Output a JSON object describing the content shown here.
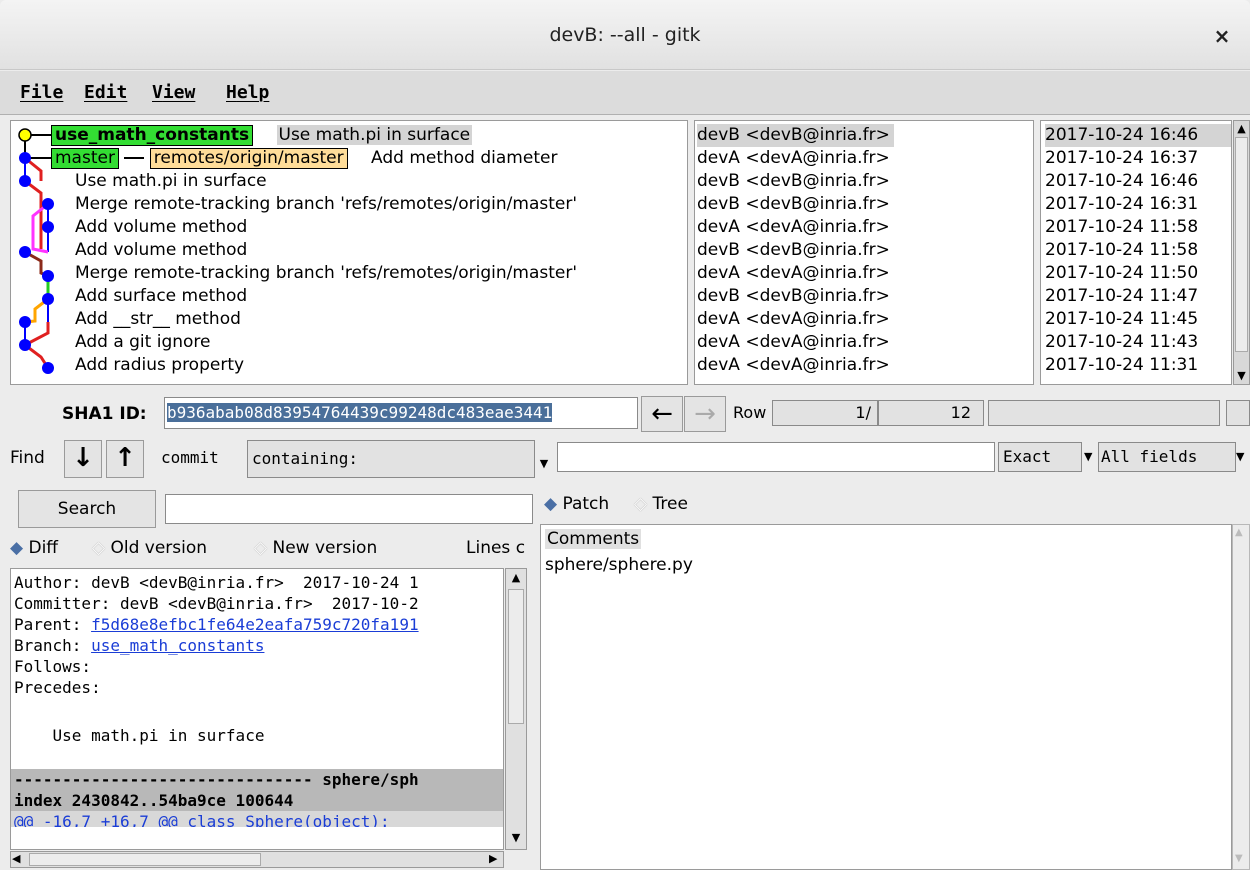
{
  "window": {
    "title": "devB: --all - gitk",
    "close": "×"
  },
  "menu": [
    "File",
    "Edit",
    "View",
    "Help"
  ],
  "commits": [
    {
      "tags": [
        {
          "label": "use_math_constants",
          "kind": "head"
        }
      ],
      "message": "Use math.pi in surface",
      "author": "devB <devB@inria.fr>",
      "date": "2017-10-24 16:46"
    },
    {
      "tags": [
        {
          "label": "master",
          "kind": "branch"
        },
        {
          "label": "remotes/origin/master",
          "kind": "remote"
        }
      ],
      "message": "Add method diameter",
      "author": "devA <devA@inria.fr>",
      "date": "2017-10-24 16:37"
    },
    {
      "tags": [],
      "message": "Use math.pi in surface",
      "author": "devB <devB@inria.fr>",
      "date": "2017-10-24 16:46"
    },
    {
      "tags": [],
      "message": "Merge remote-tracking branch 'refs/remotes/origin/master'",
      "author": "devB <devB@inria.fr>",
      "date": "2017-10-24 16:31"
    },
    {
      "tags": [],
      "message": "Add volume method",
      "author": "devA <devA@inria.fr>",
      "date": "2017-10-24 11:58"
    },
    {
      "tags": [],
      "message": "Add volume method",
      "author": "devB <devB@inria.fr>",
      "date": "2017-10-24 11:58"
    },
    {
      "tags": [],
      "message": "Merge remote-tracking branch 'refs/remotes/origin/master'",
      "author": "devA <devA@inria.fr>",
      "date": "2017-10-24 11:50"
    },
    {
      "tags": [],
      "message": "Add surface method",
      "author": "devB <devB@inria.fr>",
      "date": "2017-10-24 11:47"
    },
    {
      "tags": [],
      "message": "Add __str__ method",
      "author": "devA <devA@inria.fr>",
      "date": "2017-10-24 11:45"
    },
    {
      "tags": [],
      "message": "Add a git ignore",
      "author": "devA <devA@inria.fr>",
      "date": "2017-10-24 11:43"
    },
    {
      "tags": [],
      "message": "Add radius property",
      "author": "devA <devA@inria.fr>",
      "date": "2017-10-24 11:31"
    }
  ],
  "sha": {
    "label": "SHA1 ID:",
    "value": "b936abab08d83954764439c99248dc483eae3441",
    "back": "←",
    "forward": "→",
    "row_label": "Row",
    "row_current": "1",
    "row_total": "12"
  },
  "find": {
    "label": "Find",
    "down": "↓",
    "up": "↑",
    "type": "commit",
    "mode": "containing:",
    "match": "Exact",
    "fields": "All fields"
  },
  "search": {
    "button": "Search",
    "diff": "Diff",
    "old": "Old version",
    "new": "New version",
    "lines": "Lines c",
    "patch": "Patch",
    "tree": "Tree"
  },
  "details": {
    "author": "Author: devB <devB@inria.fr>  2017-10-24 1",
    "committer": "Committer: devB <devB@inria.fr>  2017-10-2",
    "parent_label": "Parent: ",
    "parent_sha": "f5d68e8efbc1fe64e2eafa759c720fa191",
    "branch_label": "Branch: ",
    "branch_name": "use_math_constants",
    "follows": "Follows:",
    "precedes": "Precedes:",
    "message": "    Use math.pi in surface",
    "file_header": "------------------------------- sphere/sph",
    "index": "index 2430842..54ba9ce 100644",
    "hunk": "@@ -16,7 +16,7 @@ class Sphere(object):"
  },
  "tree": {
    "comments": "Comments",
    "file": "sphere/sphere.py"
  },
  "colors": {
    "head_tag": "#33dd33",
    "remote_tag": "#ffdd99",
    "link": "#1a3dd6",
    "sha_bg": "#4a6f9a"
  }
}
